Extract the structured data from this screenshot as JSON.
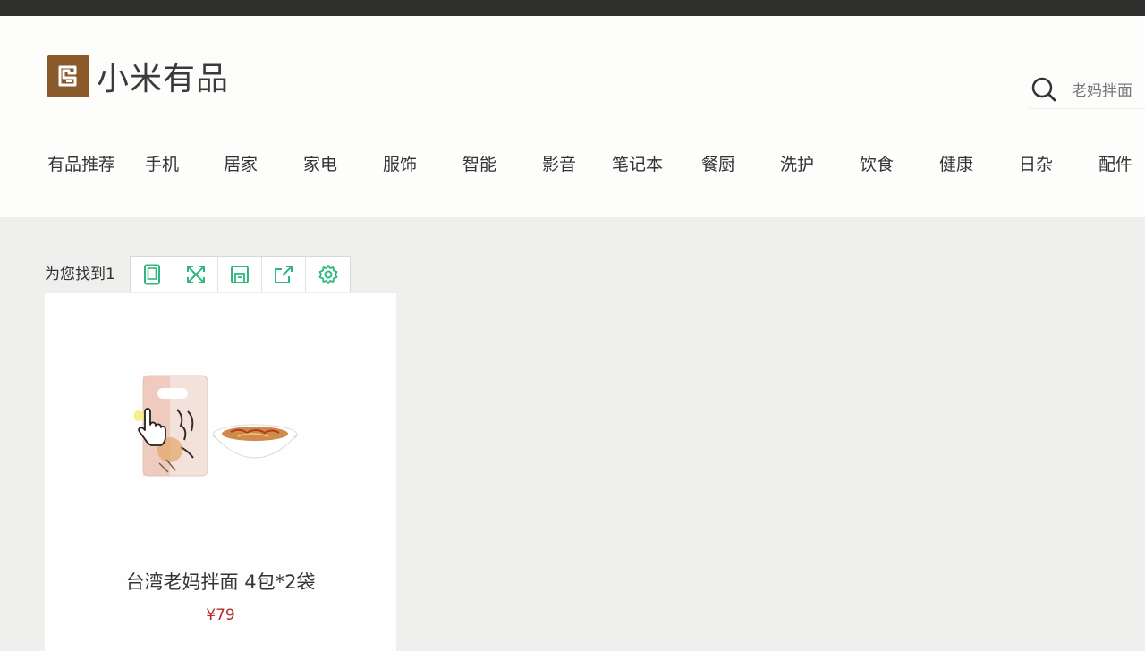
{
  "brand": {
    "name": "小米有品"
  },
  "search": {
    "value": "老妈拌面"
  },
  "nav": [
    "有品推荐",
    "手机",
    "居家",
    "家电",
    "服饰",
    "智能",
    "影音",
    "笔记本",
    "餐厨",
    "洗护",
    "饮食",
    "健康",
    "日杂",
    "配件"
  ],
  "results": {
    "summary": "为您找到1"
  },
  "toolbar": {
    "buttons": [
      {
        "icon": "tablet-icon"
      },
      {
        "icon": "expand-icon"
      },
      {
        "icon": "save-icon"
      },
      {
        "icon": "share-icon"
      },
      {
        "icon": "settings-gear-icon"
      }
    ],
    "color": "#2fb87e"
  },
  "product": {
    "name": "台湾老妈拌面 4包*2袋",
    "price": "¥79",
    "price_color": "#b8282a"
  },
  "colors": {
    "brand": "#8b5a2b",
    "topbar": "#2e2e2d",
    "background": "#efefee"
  }
}
